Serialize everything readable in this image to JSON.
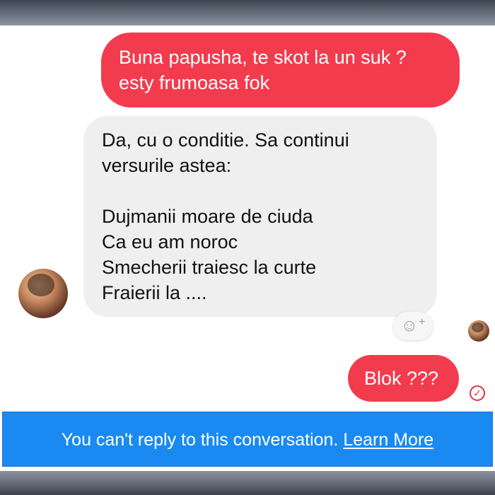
{
  "conversation": {
    "messages": [
      {
        "direction": "outgoing",
        "lines": [
          "Buna papusha, te skot la un suk ?",
          "esty frumoasa fok"
        ]
      },
      {
        "direction": "incoming",
        "lines": [
          "Da, cu o conditie. Sa continui",
          "versurile astea:",
          "",
          "Dujmanii moare de ciuda",
          "Ca eu am noroc",
          "Smecherii traiesc la curte",
          "Fraierii la ...."
        ]
      },
      {
        "direction": "outgoing",
        "lines": [
          "Blok ???"
        ]
      }
    ],
    "reaction_button": {
      "icon": "smiley-icon",
      "plus": "+"
    },
    "sent_status_icon": "check-circle-icon"
  },
  "banner": {
    "text": "You can't reply to this conversation. ",
    "link_label": "Learn More"
  },
  "colors": {
    "outgoing_bubble": "#f33b4e",
    "incoming_bubble": "#efefef",
    "banner": "#1a8af2"
  }
}
